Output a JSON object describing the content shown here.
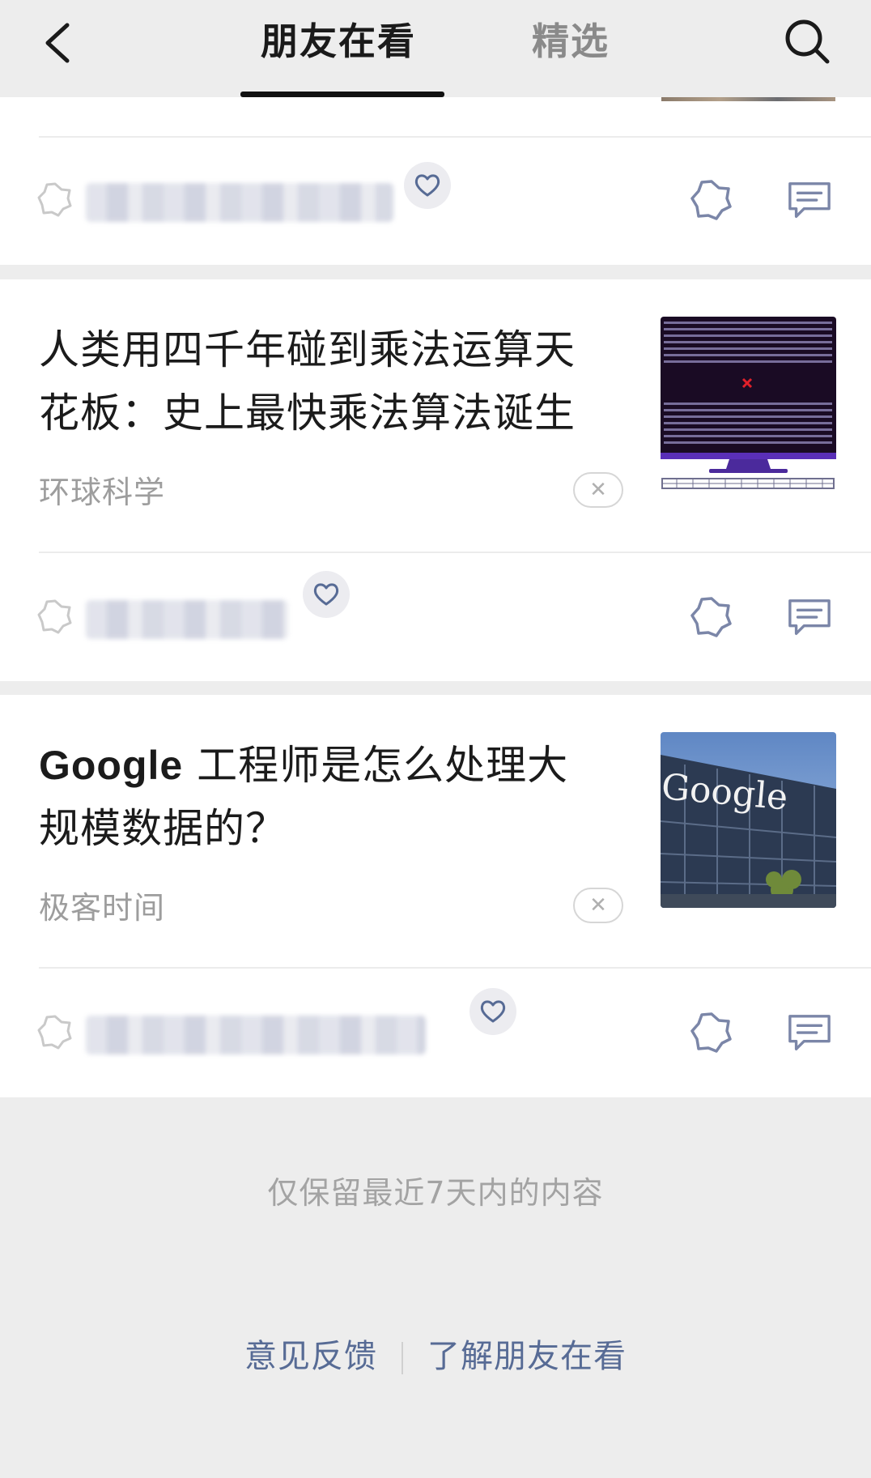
{
  "header": {
    "tab_active": "朋友在看",
    "tab_inactive": "精选"
  },
  "articles": [
    {
      "title_line1": "人类用四千年碰到乘法运算天",
      "title_line2": "花板：史上最快乘法算法诞生",
      "source": "环球科学",
      "thumb": "computer-screen-numbers"
    },
    {
      "title_latin": "Google",
      "title_line1_rest": " 工程师是怎么处理大",
      "title_line2": "规模数据的？",
      "source": "极客时间",
      "thumb": "google-building",
      "thumb_text": "Google"
    }
  ],
  "footer": {
    "note": "仅保留最近7天内的内容",
    "feedback_link": "意见反馈",
    "learn_link": "了解朋友在看"
  },
  "colors": {
    "link": "#576b95",
    "background": "#ededed",
    "icon": "#7b86a8"
  }
}
